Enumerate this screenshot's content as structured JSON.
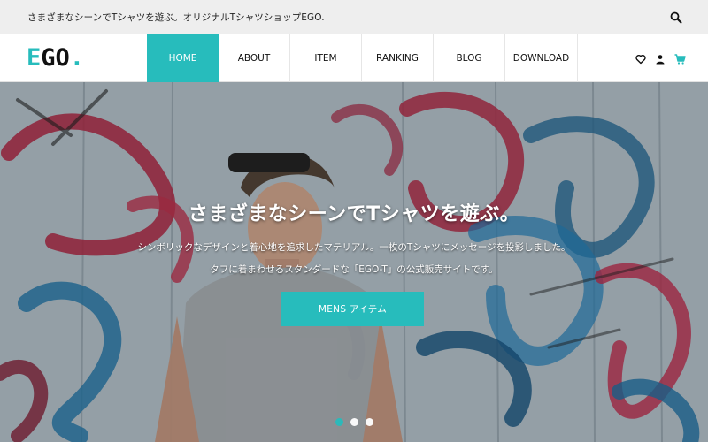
{
  "topbar": {
    "tagline": "さまざまなシーンでTシャツを遊ぶ。オリジナルTシャツショップEGO.",
    "search_icon": "search-icon"
  },
  "logo": {
    "letter_e": "E",
    "letters_go": "GO",
    "dot": "."
  },
  "nav": {
    "items": [
      {
        "label": "HOME",
        "active": true
      },
      {
        "label": "ABOUT",
        "active": false
      },
      {
        "label": "ITEM",
        "active": false
      },
      {
        "label": "RANKING",
        "active": false
      },
      {
        "label": "BLOG",
        "active": false
      },
      {
        "label": "DOWNLOAD",
        "active": false
      }
    ],
    "icons": [
      "heart-icon",
      "user-icon",
      "cart-icon"
    ]
  },
  "hero": {
    "title": "さまざまなシーンでTシャツを遊ぶ。",
    "subtitle_line1": "シンボリックなデザインと着心地を追求したマテリアル。一枚のTシャツにメッセージを投影しました。",
    "subtitle_line2": "タフに着まわせるスタンダードな「EGO-T」の公式販売サイトです。",
    "cta_label": "MENS アイテム",
    "slides": 3,
    "active_slide": 1
  },
  "colors": {
    "accent": "#27bcbc",
    "topbar_bg": "#eeeeee",
    "text": "#111111"
  }
}
